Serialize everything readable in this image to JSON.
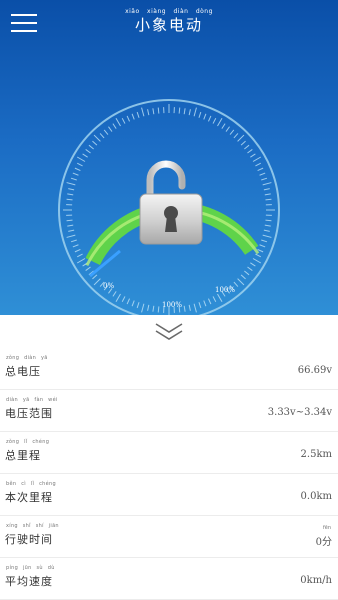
{
  "header": {
    "title_pinyin": "xiǎo xiàng diàn dòng",
    "title": "小象电动"
  },
  "gauge": {
    "min_label": "0%",
    "mid_label": "100%",
    "max_label": "100%",
    "lock_state": "unlocked",
    "colors": {
      "arc": "#5fd34a",
      "ring": "#9fd2ef",
      "marker": "#3aa0ff"
    }
  },
  "icons": {
    "menu": "menu-icon",
    "lock": "unlocked-padlock-icon",
    "expand": "double-chevron-down-icon"
  },
  "rows": [
    {
      "pinyin": "zǒng diàn yā",
      "label": "总电压",
      "value": "66.69v",
      "value_pinyin": ""
    },
    {
      "pinyin": "diàn yā fàn wéi",
      "label": "电压范围",
      "value": "3.33v~3.34v",
      "value_pinyin": ""
    },
    {
      "pinyin": "zǒng lǐ chéng",
      "label": "总里程",
      "value": "2.5km",
      "value_pinyin": ""
    },
    {
      "pinyin": "běn cì lǐ chéng",
      "label": "本次里程",
      "value": "0.0km",
      "value_pinyin": ""
    },
    {
      "pinyin": "xíng shǐ shí jiān",
      "label": "行驶时间",
      "value": "0分",
      "value_pinyin": "fēn"
    },
    {
      "pinyin": "píng jūn sù dù",
      "label": "平均速度",
      "value": "0km/h",
      "value_pinyin": ""
    }
  ]
}
